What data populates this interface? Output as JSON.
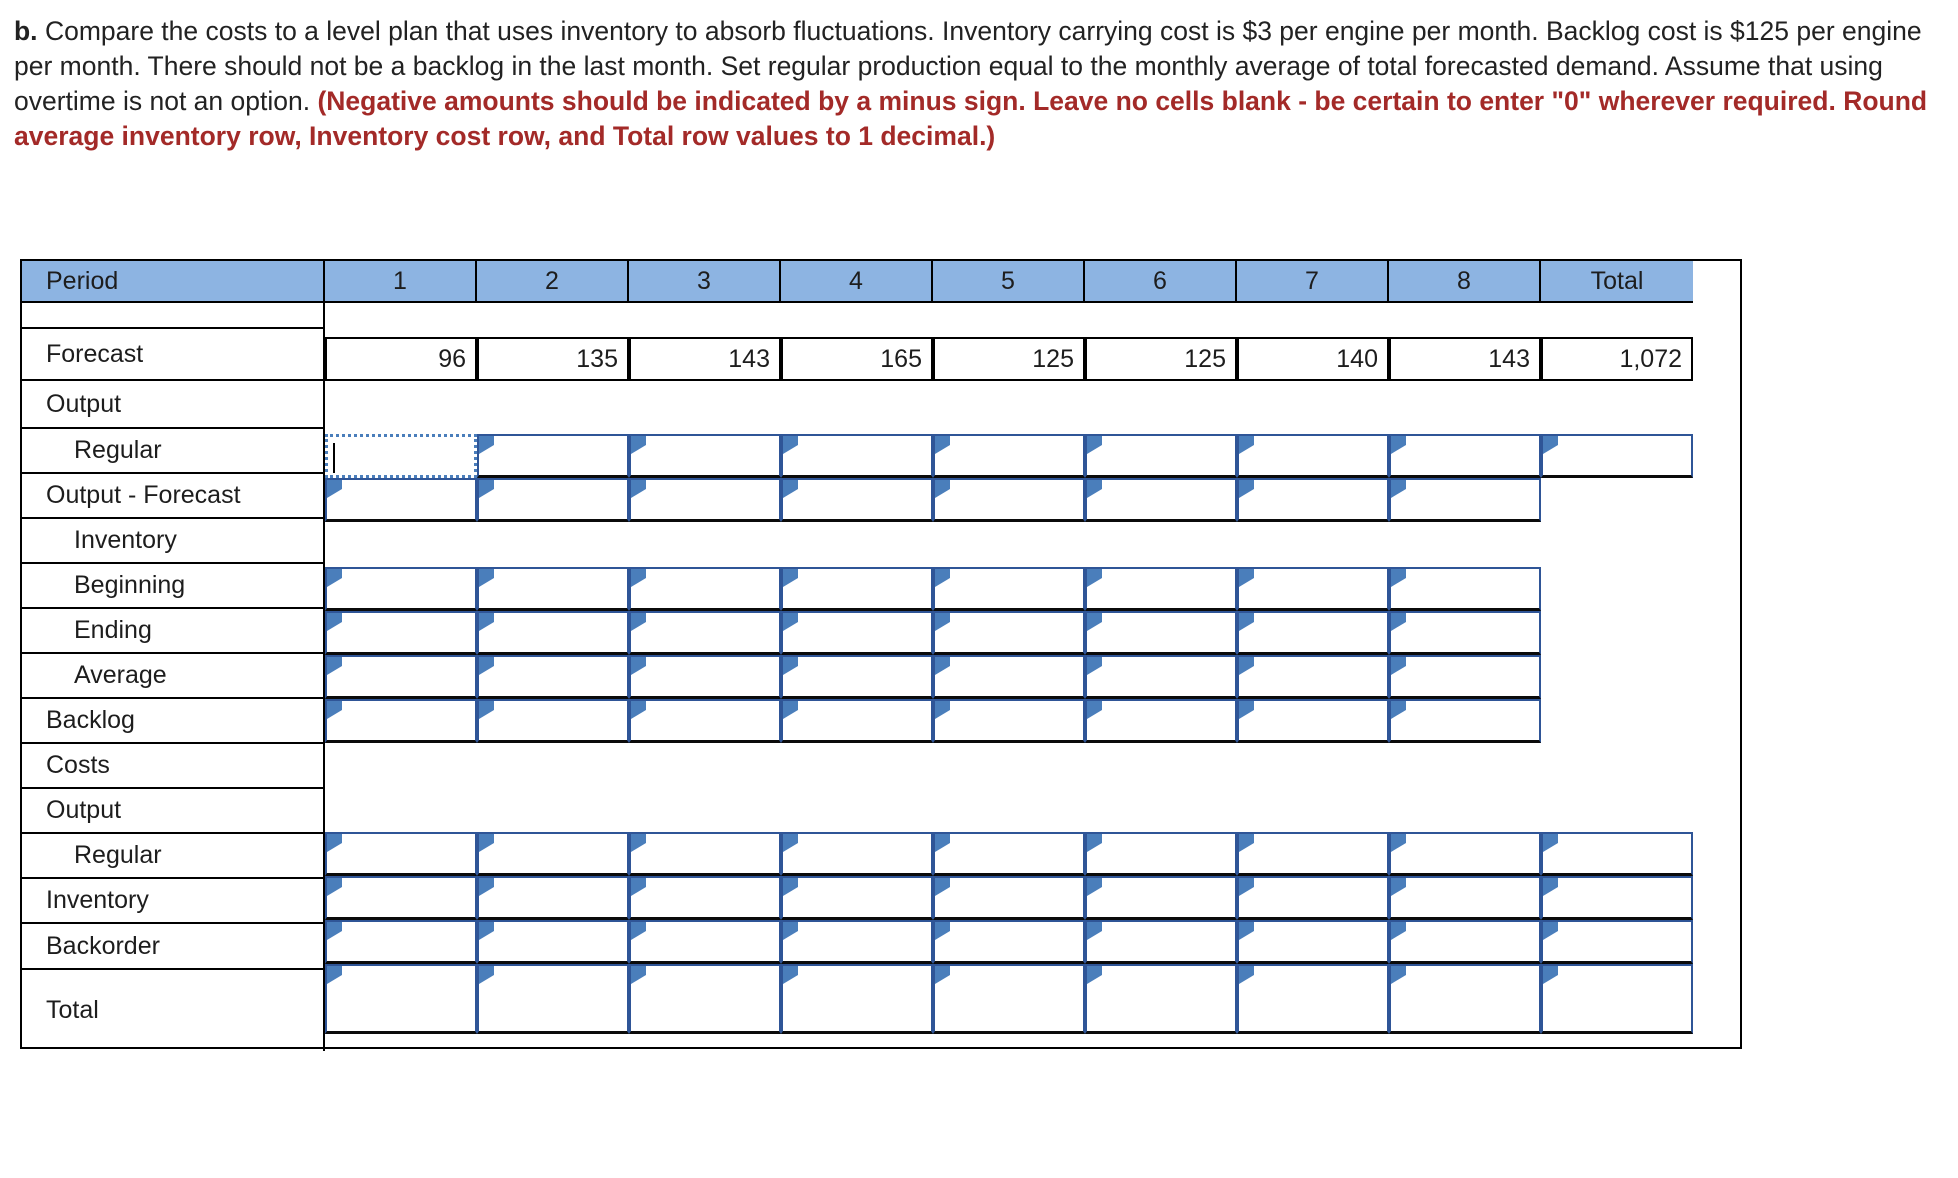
{
  "prompt": {
    "label": "b.",
    "body": "Compare the costs to a level plan that uses inventory to absorb fluctuations. Inventory carrying cost is $3 per engine per month. Backlog cost is $125 per engine per month. There should not be a backlog in the last month. Set regular production equal to the monthly average of total forecasted demand. Assume that using overtime is not an option.",
    "note": "(Negative amounts should be indicated by a minus sign. Leave no cells blank - be certain to enter \"0\" wherever required. Round average inventory row, Inventory cost row, and Total row values to 1 decimal.)"
  },
  "colors": {
    "header_blue": "#8db4e2",
    "note_red": "#a32a28",
    "cell_border_blue": "#2f5597",
    "marker_blue": "#4a7ebb"
  },
  "table": {
    "header": {
      "row_label": "Period",
      "periods": [
        "1",
        "2",
        "3",
        "4",
        "5",
        "6",
        "7",
        "8"
      ],
      "total_label": "Total"
    },
    "row_labels": [
      "Forecast",
      "Output",
      "Regular",
      "Output - Forecast",
      "Inventory",
      "Beginning",
      "Ending",
      "Average",
      "Backlog",
      "Costs",
      "Output",
      "Regular",
      "Inventory",
      "Backorder",
      "Total"
    ],
    "forecast": {
      "label": "Forecast",
      "values": [
        "96",
        "135",
        "143",
        "165",
        "125",
        "125",
        "140",
        "143"
      ],
      "total": "1,072"
    },
    "input_rows": [
      {
        "label": "Regular",
        "values": [
          "",
          "",
          "",
          "",
          "",
          "",
          "",
          ""
        ],
        "total": "",
        "has_total": true,
        "focused_index": 0
      },
      {
        "label": "Output - Forecast",
        "values": [
          "",
          "",
          "",
          "",
          "",
          "",
          "",
          ""
        ],
        "total": "",
        "has_total": false,
        "focused_index": -1
      },
      {
        "label": "Beginning",
        "values": [
          "",
          "",
          "",
          "",
          "",
          "",
          "",
          ""
        ],
        "total": "",
        "has_total": false,
        "focused_index": -1
      },
      {
        "label": "Ending",
        "values": [
          "",
          "",
          "",
          "",
          "",
          "",
          "",
          ""
        ],
        "total": "",
        "has_total": false,
        "focused_index": -1
      },
      {
        "label": "Average",
        "values": [
          "",
          "",
          "",
          "",
          "",
          "",
          "",
          ""
        ],
        "total": "",
        "has_total": false,
        "focused_index": -1
      },
      {
        "label": "Backlog",
        "values": [
          "",
          "",
          "",
          "",
          "",
          "",
          "",
          ""
        ],
        "total": "",
        "has_total": false,
        "focused_index": -1
      },
      {
        "label": "Regular",
        "values": [
          "",
          "",
          "",
          "",
          "",
          "",
          "",
          ""
        ],
        "total": "",
        "has_total": true,
        "focused_index": -1
      },
      {
        "label": "Inventory",
        "values": [
          "",
          "",
          "",
          "",
          "",
          "",
          "",
          ""
        ],
        "total": "",
        "has_total": true,
        "focused_index": -1
      },
      {
        "label": "Backorder",
        "values": [
          "",
          "",
          "",
          "",
          "",
          "",
          "",
          ""
        ],
        "total": "",
        "has_total": true,
        "focused_index": -1
      },
      {
        "label": "Total",
        "values": [
          "",
          "",
          "",
          "",
          "",
          "",
          "",
          ""
        ],
        "total": "",
        "has_total": true,
        "focused_index": -1
      }
    ]
  }
}
